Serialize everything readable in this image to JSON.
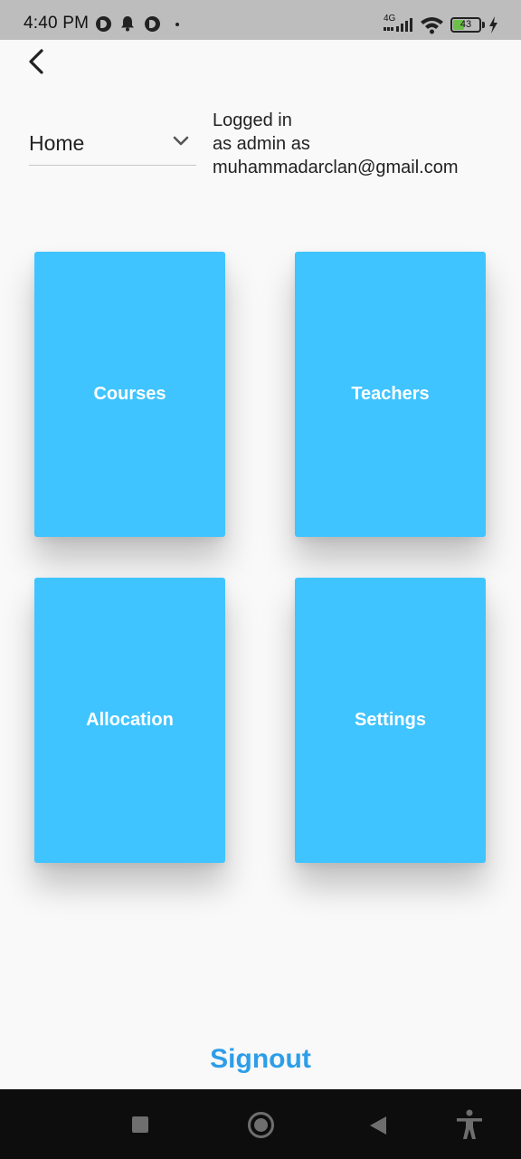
{
  "status_bar": {
    "time": "4:40 PM",
    "network": "4G",
    "battery": 43,
    "icons": [
      "notification-app-icon",
      "bell-icon",
      "notification-app-icon",
      "dot-icon",
      "signal-icon",
      "wifi-icon",
      "battery-icon",
      "charging-icon"
    ]
  },
  "header": {
    "back_icon": "back-arrow-icon"
  },
  "dropdown": {
    "value": "Home",
    "icon": "chevron-down-icon"
  },
  "login_info": {
    "line1": "Logged in",
    "line2": "as admin as",
    "line3": "muhammadarclan@gmail.com"
  },
  "tiles": [
    {
      "label": "Courses"
    },
    {
      "label": "Teachers"
    },
    {
      "label": "Allocation"
    },
    {
      "label": "Settings"
    }
  ],
  "signout_label": "Signout",
  "nav_bar": {
    "icons": [
      "recents-icon",
      "home-icon",
      "back-icon",
      "accessibility-icon"
    ]
  },
  "colors": {
    "tile": "#40c4ff",
    "signout": "#2d9ee8",
    "status_bar": "#bdbdbd",
    "nav_bar": "#0d0d0d"
  }
}
